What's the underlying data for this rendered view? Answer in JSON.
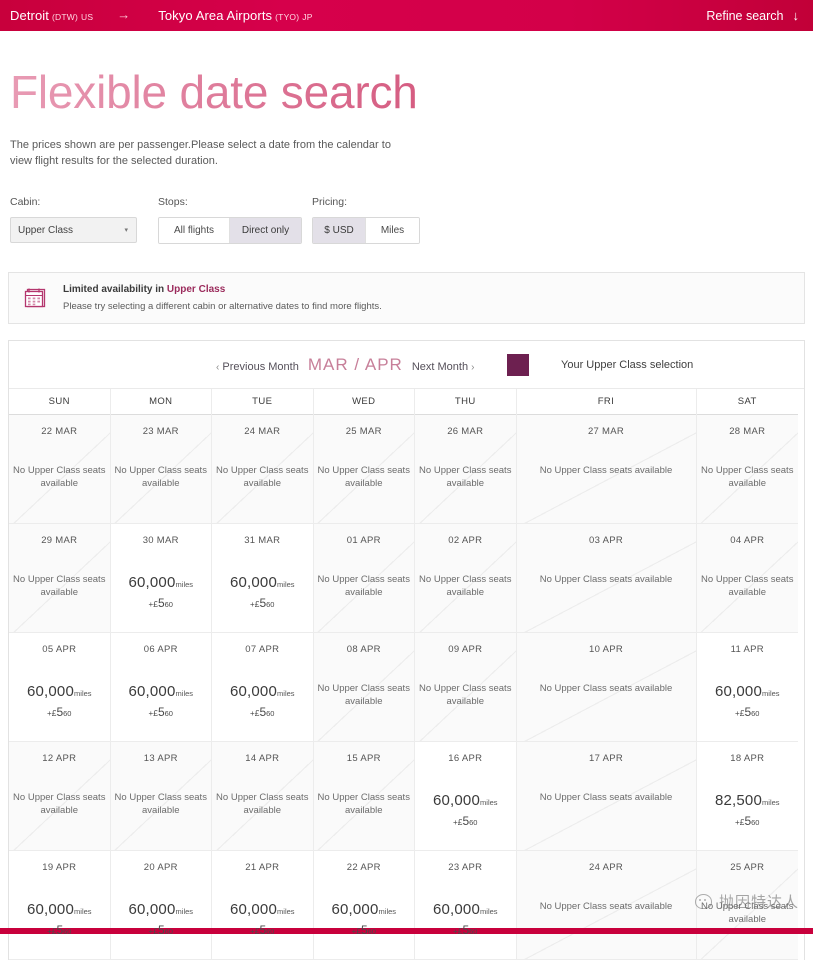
{
  "route_bar": {
    "origin_city": "Detroit",
    "origin_code": "(DTW)",
    "origin_country": "US",
    "arrow": "→",
    "dest_city": "Tokyo Area Airports",
    "dest_code": "(TYO)",
    "dest_country": "JP",
    "refine_label": "Refine search",
    "refine_arrow": "↓",
    "bg_color": "#d6004b"
  },
  "page": {
    "title": "Flexible date search",
    "lede": "The prices shown are per passenger.Please select a date from the calendar to view flight results for the selected duration."
  },
  "filters": {
    "cabin": {
      "label": "Cabin:",
      "selected": "Upper Class",
      "caret": "▾"
    },
    "stops": {
      "label": "Stops:",
      "options": [
        {
          "label": "All flights",
          "active": false
        },
        {
          "label": "Direct only",
          "active": true
        }
      ]
    },
    "pricing": {
      "label": "Pricing:",
      "options": [
        {
          "label": "$ USD",
          "active": true
        },
        {
          "label": "Miles",
          "active": false
        }
      ]
    }
  },
  "notice": {
    "icon": "calendar-icon",
    "title_prefix": "Limited availability in ",
    "title_highlight": "Upper Class",
    "subtitle": "Please try selecting a different cabin or alternative dates to find more flights.",
    "icon_color": "#b4376e"
  },
  "calendar": {
    "prev_label": "Previous Month",
    "prev_chevron": "‹",
    "months": "MAR / APR",
    "next_label": "Next Month",
    "next_chevron": "›",
    "legend_label": "Your Upper Class selection",
    "legend_color": "#6d2050",
    "day_headers": [
      "SUN",
      "MON",
      "TUE",
      "WED",
      "THU",
      "FRI",
      "SAT"
    ],
    "no_seats_text": "No Upper Class seats available",
    "miles_unit": "miles",
    "tax_plus": "+",
    "tax_currency": "£",
    "tax_whole": "5",
    "tax_cents": "60",
    "weeks": [
      [
        {
          "date": "22 MAR",
          "available": false
        },
        {
          "date": "23 MAR",
          "available": false
        },
        {
          "date": "24 MAR",
          "available": false
        },
        {
          "date": "25 MAR",
          "available": false
        },
        {
          "date": "26 MAR",
          "available": false
        },
        {
          "date": "27 MAR",
          "available": false
        },
        {
          "date": "28 MAR",
          "available": false
        }
      ],
      [
        {
          "date": "29 MAR",
          "available": false
        },
        {
          "date": "30 MAR",
          "available": true,
          "miles": "60,000"
        },
        {
          "date": "31 MAR",
          "available": true,
          "miles": "60,000"
        },
        {
          "date": "01 APR",
          "available": false
        },
        {
          "date": "02 APR",
          "available": false
        },
        {
          "date": "03 APR",
          "available": false
        },
        {
          "date": "04 APR",
          "available": false
        }
      ],
      [
        {
          "date": "05 APR",
          "available": true,
          "miles": "60,000"
        },
        {
          "date": "06 APR",
          "available": true,
          "miles": "60,000"
        },
        {
          "date": "07 APR",
          "available": true,
          "miles": "60,000"
        },
        {
          "date": "08 APR",
          "available": false
        },
        {
          "date": "09 APR",
          "available": false
        },
        {
          "date": "10 APR",
          "available": false
        },
        {
          "date": "11 APR",
          "available": true,
          "miles": "60,000"
        }
      ],
      [
        {
          "date": "12 APR",
          "available": false
        },
        {
          "date": "13 APR",
          "available": false
        },
        {
          "date": "14 APR",
          "available": false
        },
        {
          "date": "15 APR",
          "available": false
        },
        {
          "date": "16 APR",
          "available": true,
          "miles": "60,000"
        },
        {
          "date": "17 APR",
          "available": false
        },
        {
          "date": "18 APR",
          "available": true,
          "miles": "82,500"
        }
      ],
      [
        {
          "date": "19 APR",
          "available": true,
          "miles": "60,000"
        },
        {
          "date": "20 APR",
          "available": true,
          "miles": "60,000"
        },
        {
          "date": "21 APR",
          "available": true,
          "miles": "60,000"
        },
        {
          "date": "22 APR",
          "available": true,
          "miles": "60,000"
        },
        {
          "date": "23 APR",
          "available": true,
          "miles": "60,000"
        },
        {
          "date": "24 APR",
          "available": false
        },
        {
          "date": "25 APR",
          "available": false
        }
      ]
    ]
  },
  "watermark": {
    "text": "抛因特达人",
    "logo": "wechat-icon"
  }
}
